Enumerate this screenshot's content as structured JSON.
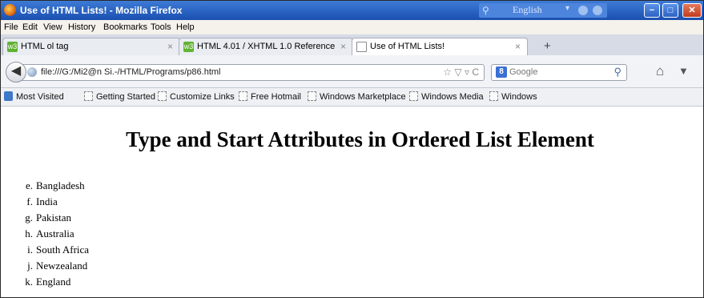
{
  "window": {
    "title": "Use of HTML Lists! - Mozilla Firefox",
    "language_label": "English",
    "controls": {
      "minimize": "−",
      "maximize": "□",
      "close": "✕"
    }
  },
  "menu": [
    "File",
    "Edit",
    "View",
    "History",
    "Bookmarks",
    "Tools",
    "Help"
  ],
  "tabs": [
    {
      "label": "HTML ol tag",
      "close": "×",
      "active": false
    },
    {
      "label": "HTML 4.01 / XHTML 1.0 Reference",
      "close": "×",
      "active": false
    },
    {
      "label": "Use of HTML Lists!",
      "close": "×",
      "active": true
    }
  ],
  "new_tab": "+",
  "navbar": {
    "url": "file:///G:/Mi2@n Si.-/HTML/Programs/p86.html",
    "search_placeholder": "Google"
  },
  "bookmarks": [
    "Most Visited",
    "Getting Started",
    "Customize Links",
    "Free Hotmail",
    "Windows Marketplace",
    "Windows Media",
    "Windows"
  ],
  "page": {
    "heading": "Type and Start Attributes in Ordered List Element",
    "list": [
      {
        "marker": "e.",
        "text": "Bangladesh"
      },
      {
        "marker": "f.",
        "text": "India"
      },
      {
        "marker": "g.",
        "text": "Pakistan"
      },
      {
        "marker": "h.",
        "text": "Australia"
      },
      {
        "marker": "i.",
        "text": "South Africa"
      },
      {
        "marker": "j.",
        "text": "Newzealand"
      },
      {
        "marker": "k.",
        "text": "England"
      }
    ]
  },
  "icons": {
    "app": "firefox-icon",
    "back": "back-arrow-icon",
    "home": "home-icon",
    "pocket": "pocket-icon"
  },
  "colors": {
    "titlebar": "#1b4fb0",
    "close_button": "#c23a1d",
    "tab_favicon": "#5fb332"
  }
}
